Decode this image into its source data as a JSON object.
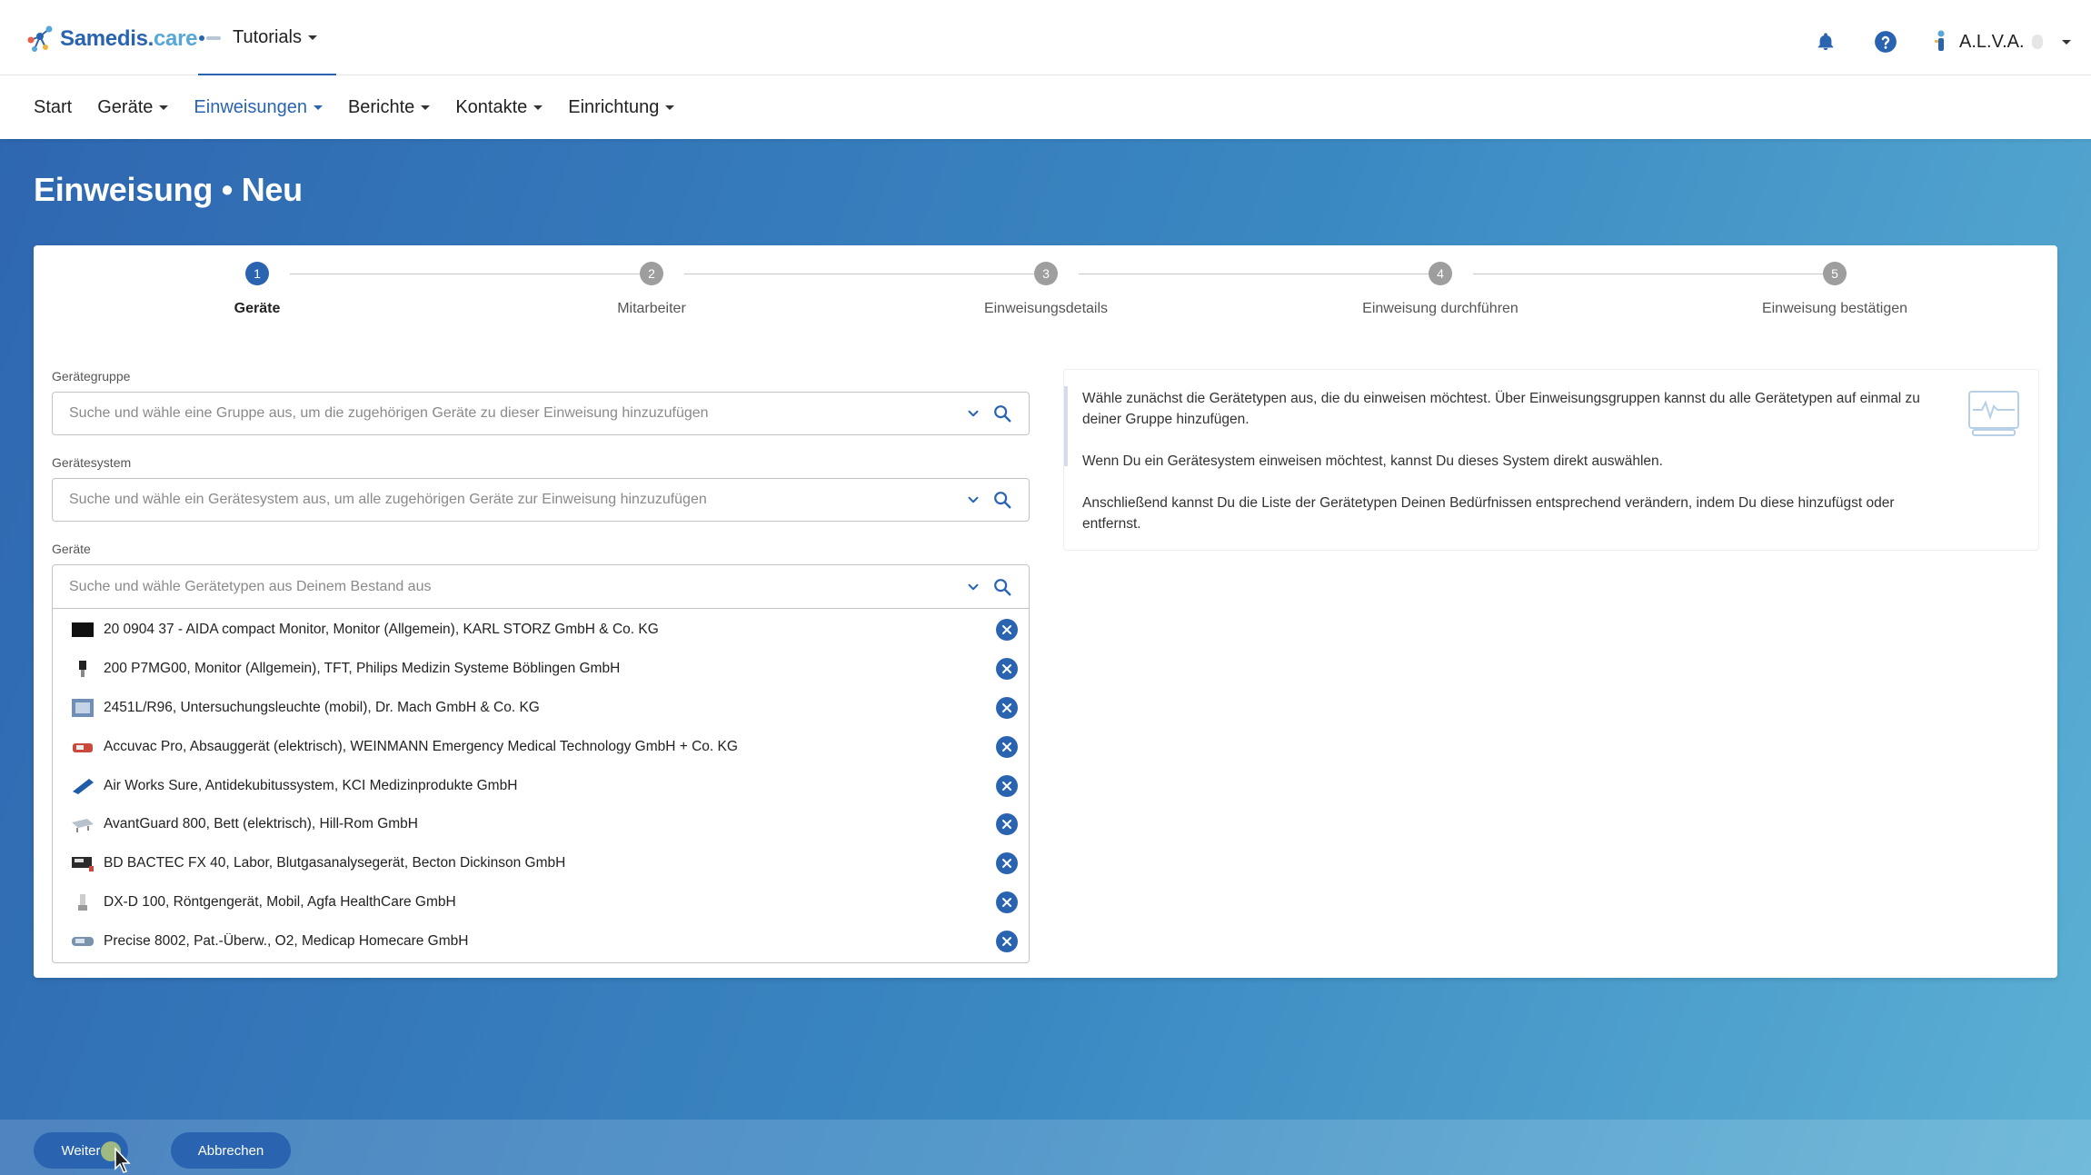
{
  "header": {
    "brand_main": "Samedis.",
    "brand_sub": "care",
    "workspace": "Tutorials",
    "user": "A.L.V.A."
  },
  "nav": {
    "items": [
      {
        "label": "Start",
        "dropdown": false,
        "active": false
      },
      {
        "label": "Geräte",
        "dropdown": true,
        "active": false
      },
      {
        "label": "Einweisungen",
        "dropdown": true,
        "active": true
      },
      {
        "label": "Berichte",
        "dropdown": true,
        "active": false
      },
      {
        "label": "Kontakte",
        "dropdown": true,
        "active": false
      },
      {
        "label": "Einrichtung",
        "dropdown": true,
        "active": false
      }
    ]
  },
  "page": {
    "title": "Einweisung • Neu"
  },
  "stepper": {
    "steps": [
      {
        "number": "1",
        "label": "Geräte",
        "active": true
      },
      {
        "number": "2",
        "label": "Mitarbeiter",
        "active": false
      },
      {
        "number": "3",
        "label": "Einweisungsdetails",
        "active": false
      },
      {
        "number": "4",
        "label": "Einweisung durchführen",
        "active": false
      },
      {
        "number": "5",
        "label": "Einweisung bestätigen",
        "active": false
      }
    ]
  },
  "form": {
    "group": {
      "label": "Gerätegruppe",
      "placeholder": "Suche und wähle eine Gruppe aus, um die zugehörigen Geräte zu dieser Einweisung hinzuzufügen"
    },
    "system": {
      "label": "Gerätesystem",
      "placeholder": "Suche und wähle ein Gerätesystem aus, um alle zugehörigen Geräte zur Einweisung hinzuzufügen"
    },
    "devices": {
      "label": "Geräte",
      "placeholder": "Suche und wähle Gerätetypen aus Deinem Bestand aus",
      "items": [
        "20 0904 37 - AIDA compact Monitor, Monitor (Allgemein), KARL STORZ GmbH & Co. KG",
        "200 P7MG00, Monitor (Allgemein), TFT, Philips Medizin Systeme Böblingen GmbH",
        "2451L/R96, Untersuchungsleuchte (mobil), Dr. Mach GmbH & Co. KG",
        "Accuvac Pro, Absauggerät (elektrisch), WEINMANN Emergency Medical Technology GmbH + Co. KG",
        "Air Works Sure, Antidekubitussystem, KCI Medizinprodukte GmbH",
        "AvantGuard 800, Bett (elektrisch), Hill-Rom GmbH",
        "BD BACTEC FX 40, Labor, Blutgasanalysegerät, Becton Dickinson GmbH",
        "DX-D 100, Röntgengerät, Mobil, Agfa HealthCare GmbH",
        "Precise 8002, Pat.-Überw., O2, Medicap Homecare GmbH"
      ]
    }
  },
  "info": {
    "paragraphs": [
      "Wähle zunächst die Gerätetypen aus, die du einweisen möchtest. Über Einweisungsgruppen kannst du alle Gerätetypen auf einmal zu deiner Gruppe hinzufügen.",
      "Wenn Du ein Gerätesystem einweisen möchtest, kannst Du dieses System direkt auswählen.",
      "Anschließend kannst Du die Liste der Gerätetypen Deinen Bedürfnissen entsprechend verändern, indem Du diese hinzufügst oder entfernst."
    ]
  },
  "actions": {
    "next": "Weiter",
    "cancel": "Abbrechen"
  },
  "colors": {
    "primary": "#2a64b0",
    "accent": "#57a7d9"
  }
}
